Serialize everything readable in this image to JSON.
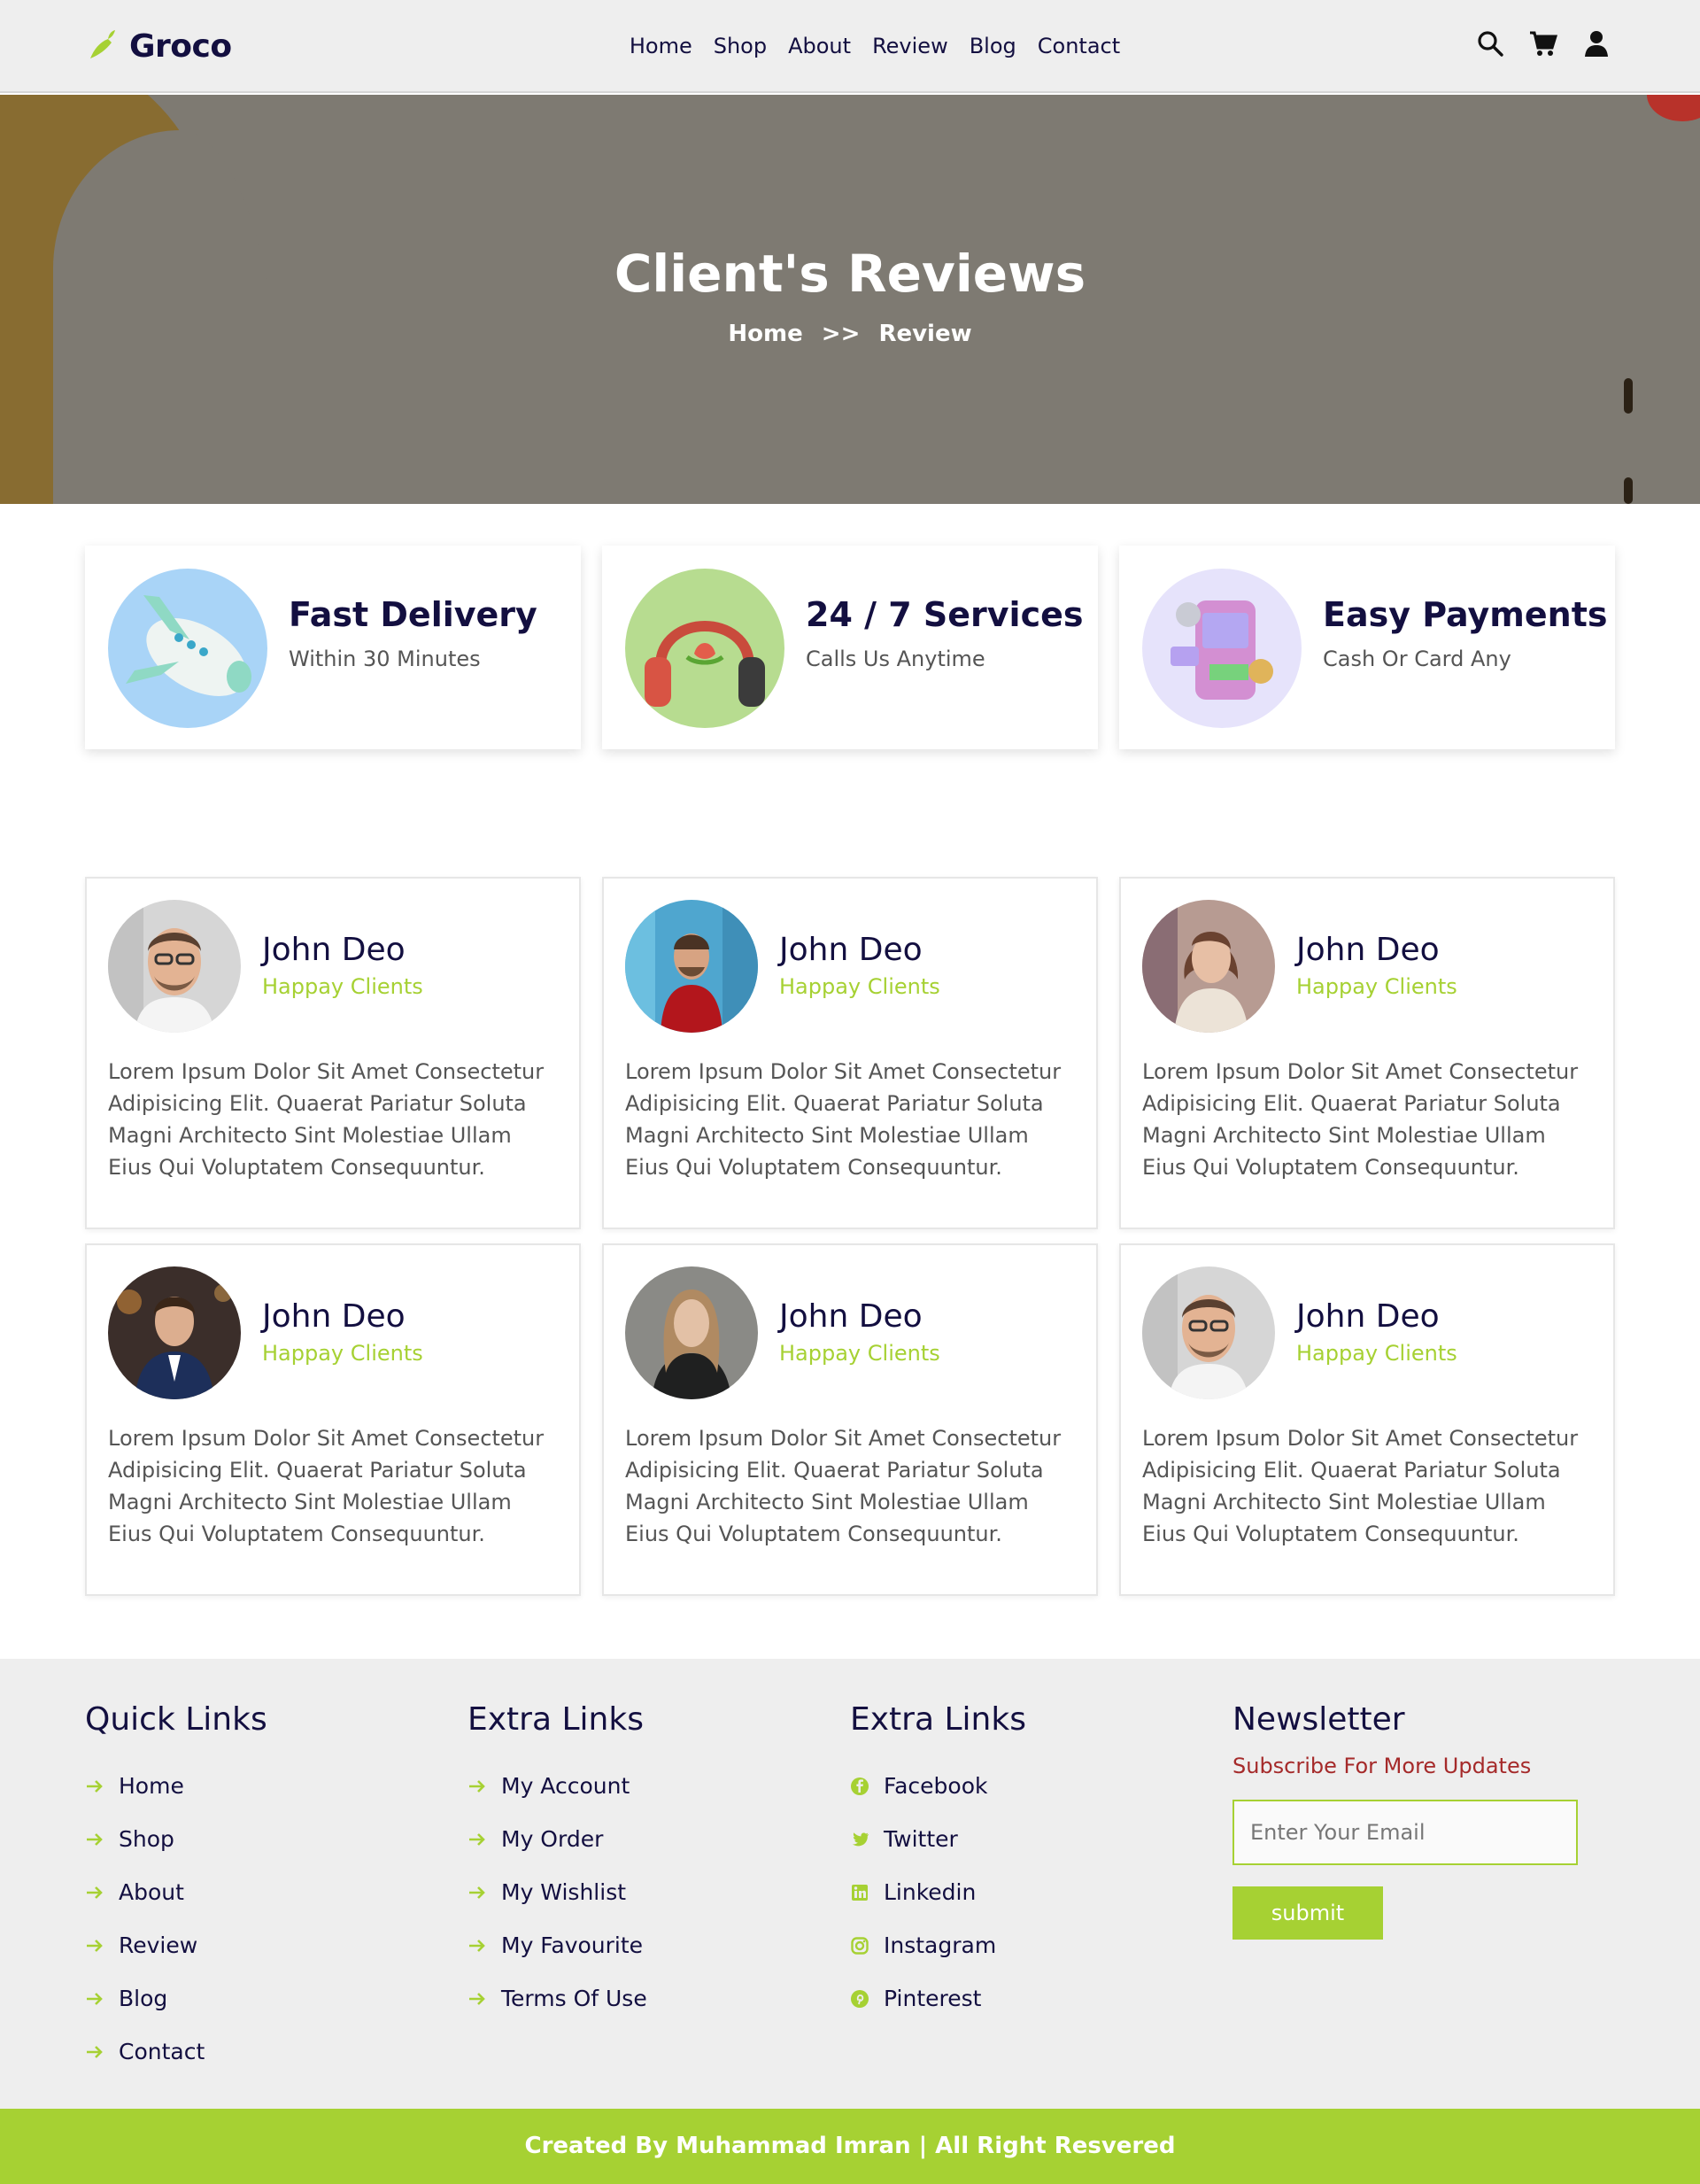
{
  "brand": {
    "name": "Groco",
    "accent": "#a6d133",
    "dark": "#130f40"
  },
  "nav": {
    "items": [
      "Home",
      "Shop",
      "About",
      "Review",
      "Blog",
      "Contact"
    ]
  },
  "header_icons": [
    "search-icon",
    "cart-icon",
    "user-icon"
  ],
  "hero": {
    "title": "Client's Reviews",
    "crumb_home": "Home",
    "crumb_sep": ">>",
    "crumb_current": "Review"
  },
  "features": [
    {
      "title": "Fast Delivery",
      "subtitle": "Within 30 Minutes",
      "icon": "airplane-icon"
    },
    {
      "title": "24 / 7 Services",
      "subtitle": "Calls Us Anytime",
      "icon": "headphones-icon"
    },
    {
      "title": "Easy Payments",
      "subtitle": "Cash Or Card Any",
      "icon": "payment-phone-icon"
    }
  ],
  "reviews": [
    {
      "name": "John Deo",
      "role": "Happay Clients",
      "text": "Lorem Ipsum Dolor Sit Amet Consectetur Adipisicing Elit. Quaerat Pariatur Soluta Magni Architecto Sint Molestiae Ullam Eius Qui Voluptatem Consequuntur."
    },
    {
      "name": "John Deo",
      "role": "Happay Clients",
      "text": "Lorem Ipsum Dolor Sit Amet Consectetur Adipisicing Elit. Quaerat Pariatur Soluta Magni Architecto Sint Molestiae Ullam Eius Qui Voluptatem Consequuntur."
    },
    {
      "name": "John Deo",
      "role": "Happay Clients",
      "text": "Lorem Ipsum Dolor Sit Amet Consectetur Adipisicing Elit. Quaerat Pariatur Soluta Magni Architecto Sint Molestiae Ullam Eius Qui Voluptatem Consequuntur."
    },
    {
      "name": "John Deo",
      "role": "Happay Clients",
      "text": "Lorem Ipsum Dolor Sit Amet Consectetur Adipisicing Elit. Quaerat Pariatur Soluta Magni Architecto Sint Molestiae Ullam Eius Qui Voluptatem Consequuntur."
    },
    {
      "name": "John Deo",
      "role": "Happay Clients",
      "text": "Lorem Ipsum Dolor Sit Amet Consectetur Adipisicing Elit. Quaerat Pariatur Soluta Magni Architecto Sint Molestiae Ullam Eius Qui Voluptatem Consequuntur."
    },
    {
      "name": "John Deo",
      "role": "Happay Clients",
      "text": "Lorem Ipsum Dolor Sit Amet Consectetur Adipisicing Elit. Quaerat Pariatur Soluta Magni Architecto Sint Molestiae Ullam Eius Qui Voluptatem Consequuntur."
    }
  ],
  "footer": {
    "quick": {
      "title": "Quick Links",
      "items": [
        "Home",
        "Shop",
        "About",
        "Review",
        "Blog",
        "Contact"
      ]
    },
    "extra": {
      "title": "Extra Links",
      "items": [
        "My Account",
        "My Order",
        "My Wishlist",
        "My Favourite",
        "Terms Of Use"
      ]
    },
    "social": {
      "title": "Extra Links",
      "items": [
        "Facebook",
        "Twitter",
        "Linkedin",
        "Instagram",
        "Pinterest"
      ]
    },
    "newsletter": {
      "title": "Newsletter",
      "subtitle": "Subscribe For More Updates",
      "placeholder": "Enter Your Email",
      "button": "submit"
    }
  },
  "credit": "Created By Muhammad Imran | All Right Resvered"
}
